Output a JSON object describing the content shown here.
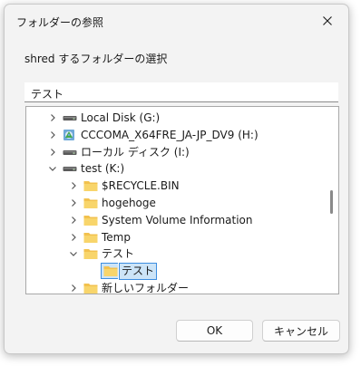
{
  "dialog": {
    "title": "フォルダーの参照",
    "description": "shred するフォルダーの選択",
    "path_value": "テスト"
  },
  "tree": {
    "items": [
      {
        "label": "Local Disk (G:)",
        "icon": "drive-icon",
        "state": "collapsed",
        "depth": 1,
        "selected": false
      },
      {
        "label": "CCCOMA_X64FRE_JA-JP_DV9 (H:)",
        "icon": "disc-icon",
        "state": "collapsed",
        "depth": 1,
        "selected": false
      },
      {
        "label": "ローカル ディスク (I:)",
        "icon": "drive-icon",
        "state": "collapsed",
        "depth": 1,
        "selected": false
      },
      {
        "label": "test (K:)",
        "icon": "drive-icon",
        "state": "expanded",
        "depth": 1,
        "selected": false
      },
      {
        "label": "$RECYCLE.BIN",
        "icon": "folder-icon",
        "state": "collapsed",
        "depth": 2,
        "selected": false
      },
      {
        "label": "hogehoge",
        "icon": "folder-icon",
        "state": "collapsed",
        "depth": 2,
        "selected": false
      },
      {
        "label": "System Volume Information",
        "icon": "folder-icon",
        "state": "collapsed",
        "depth": 2,
        "selected": false
      },
      {
        "label": "Temp",
        "icon": "folder-icon",
        "state": "collapsed",
        "depth": 2,
        "selected": false
      },
      {
        "label": "テスト",
        "icon": "folder-icon",
        "state": "expanded",
        "depth": 2,
        "selected": false
      },
      {
        "label": "テスト",
        "icon": "folder-icon",
        "state": "none",
        "depth": 3,
        "selected": true
      },
      {
        "label": "新しいフォルダー",
        "icon": "folder-icon",
        "state": "collapsed",
        "depth": 2,
        "selected": false
      }
    ]
  },
  "buttons": {
    "ok": "OK",
    "cancel": "キャンセル"
  },
  "colors": {
    "folder": "#f2c14e",
    "selection_bg": "#cce4f7",
    "selection_border": "#3d8ee0"
  }
}
